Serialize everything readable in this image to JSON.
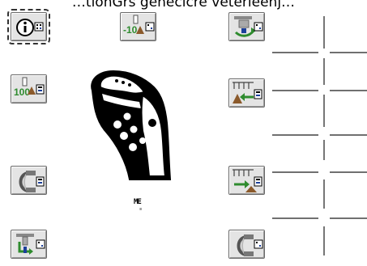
{
  "header": {
    "text": "…tionGrs geneclcre veterleenj…"
  },
  "buttons": {
    "info": {
      "icon": "info-icon"
    },
    "minus_10": {
      "icon": "minus-10-icon",
      "label": "-10"
    },
    "scale_rotate": {
      "icon": "scale-rotate-icon"
    },
    "hundred": {
      "icon": "100-percent-icon",
      "label": "100"
    },
    "arrow_left": {
      "icon": "nozzle-arrow-left-icon"
    },
    "hose_left": {
      "icon": "hose-icon"
    },
    "arrow_right": {
      "icon": "nozzle-arrow-right-icon"
    },
    "scale_down": {
      "icon": "scale-down-icon"
    },
    "hose_right": {
      "icon": "hose-icon"
    }
  },
  "device": {
    "label": "ME",
    "sublabel": "≡"
  },
  "colors": {
    "button_bg": "#e4e4e4",
    "green": "#2e8b2e",
    "brown": "#8b5a2b",
    "blue": "#1b3f9a"
  }
}
